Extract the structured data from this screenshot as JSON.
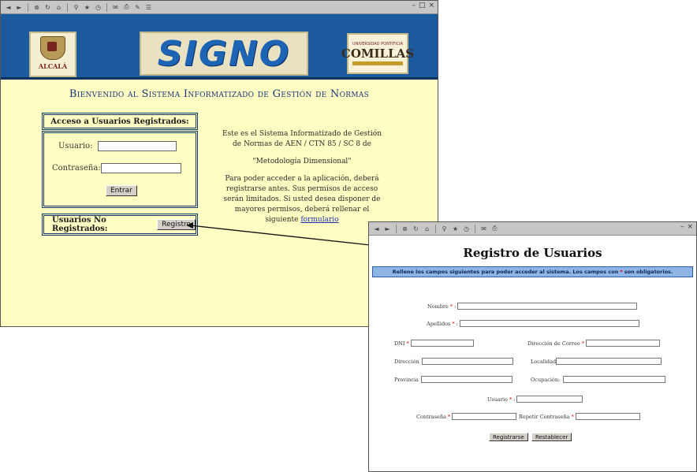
{
  "main_window": {
    "banner": {
      "alcala_logo_text": "ALCALÁ",
      "signo_logo_text": "SIGNO",
      "comillas_logo_text": "COMILLAS",
      "comillas_logo_top": "UNIVERSIDAD PONTIFICIA"
    },
    "welcome": "Bienvenido al Sistema Informatizado de Gestión de Normas",
    "login": {
      "title": "Acceso a Usuarios Registrados:",
      "user_label": "Usuario:",
      "user_value": "",
      "password_label": "Contraseña:",
      "password_value": "",
      "submit_label": "Entrar"
    },
    "unregistered": {
      "label": "Usuarios No Registrados:",
      "button_label": "Registro"
    },
    "info": {
      "p1": "Este es el Sistema Informatizado de Gestión de Normas de AEN / CTN 85 / SC 8 de",
      "p2": "\"Metodología Dimensional\"",
      "p3_text": "Para poder acceder a la aplicación, deberá registrarse antes. Sus permisos de acceso serán limitados. Si usted desea disponer de mayores permisos, deberá rellenar el siguiente",
      "p3_link": "formulario"
    }
  },
  "registro_window": {
    "title": "Registro de Usuarios",
    "instructions_before": "Rellene los campos siguientes para poder acceder al sistema. Los campos con",
    "instructions_star": "*",
    "instructions_after": "son obligatorios.",
    "required_mark": "*",
    "fields": {
      "nombre": "Nombre",
      "apellidos": "Apellidos",
      "dni": "DNI",
      "correo": "Dirección de Correo",
      "direccion": "Dirección",
      "localidad": "Localidad",
      "provincia": "Provincia",
      "ocupacion": "Ocupación",
      "usuario": "Usuario",
      "contrasena": "Contraseña",
      "repetir": "Repetir Contraseña"
    },
    "buttons": {
      "register": "Registrarse",
      "reset": "Restablecer"
    }
  },
  "colors": {
    "banner_blue": "#1c5aa0",
    "page_yellow": "#ffffc4",
    "required_red": "#d40000",
    "bar_blue": "#8fb4e6"
  }
}
